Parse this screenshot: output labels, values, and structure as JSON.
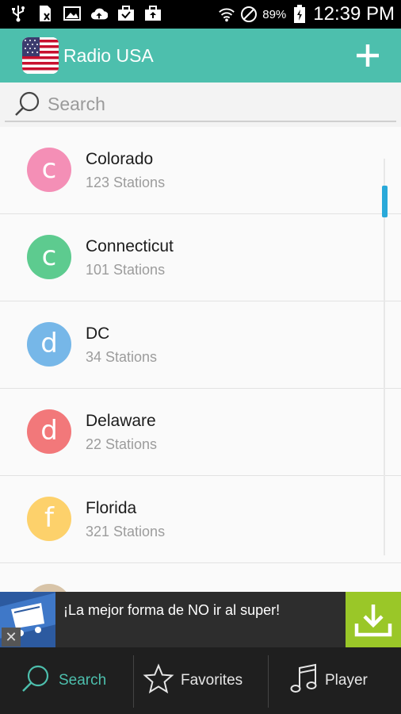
{
  "status_bar": {
    "battery": "89%",
    "time": "12:39 PM",
    "icons": [
      "usb-icon",
      "sim-icon",
      "image-icon",
      "cloud-upload-icon",
      "briefcase-icon",
      "briefcase-upload-icon",
      "wifi-icon",
      "dnd-icon",
      "battery-icon"
    ]
  },
  "app_bar": {
    "title": "Radio USA",
    "add_icon": "plus-icon",
    "theme_color": "#4dbfad"
  },
  "search": {
    "placeholder": "Search",
    "value": ""
  },
  "list": {
    "items": [
      {
        "initial": "c",
        "name": "Colorado",
        "count": "123 Stations",
        "color": "#f48fb6"
      },
      {
        "initial": "c",
        "name": "Connecticut",
        "count": "101 Stations",
        "color": "#5dcb8f"
      },
      {
        "initial": "d",
        "name": "DC",
        "count": "34 Stations",
        "color": "#76b7e8"
      },
      {
        "initial": "d",
        "name": "Delaware",
        "count": "22 Stations",
        "color": "#f2787a"
      },
      {
        "initial": "f",
        "name": "Florida",
        "count": "321 Stations",
        "color": "#fdd16b"
      }
    ]
  },
  "ad": {
    "text": "¡La mejor forma de NO ir al super!",
    "close": "✕",
    "download_color": "#9ac728"
  },
  "bottom_nav": {
    "items": [
      {
        "label": "Search",
        "icon": "search-icon",
        "active": true
      },
      {
        "label": "Favorites",
        "icon": "star-icon",
        "active": false
      },
      {
        "label": "Player",
        "icon": "music-note-icon",
        "active": false
      }
    ]
  }
}
